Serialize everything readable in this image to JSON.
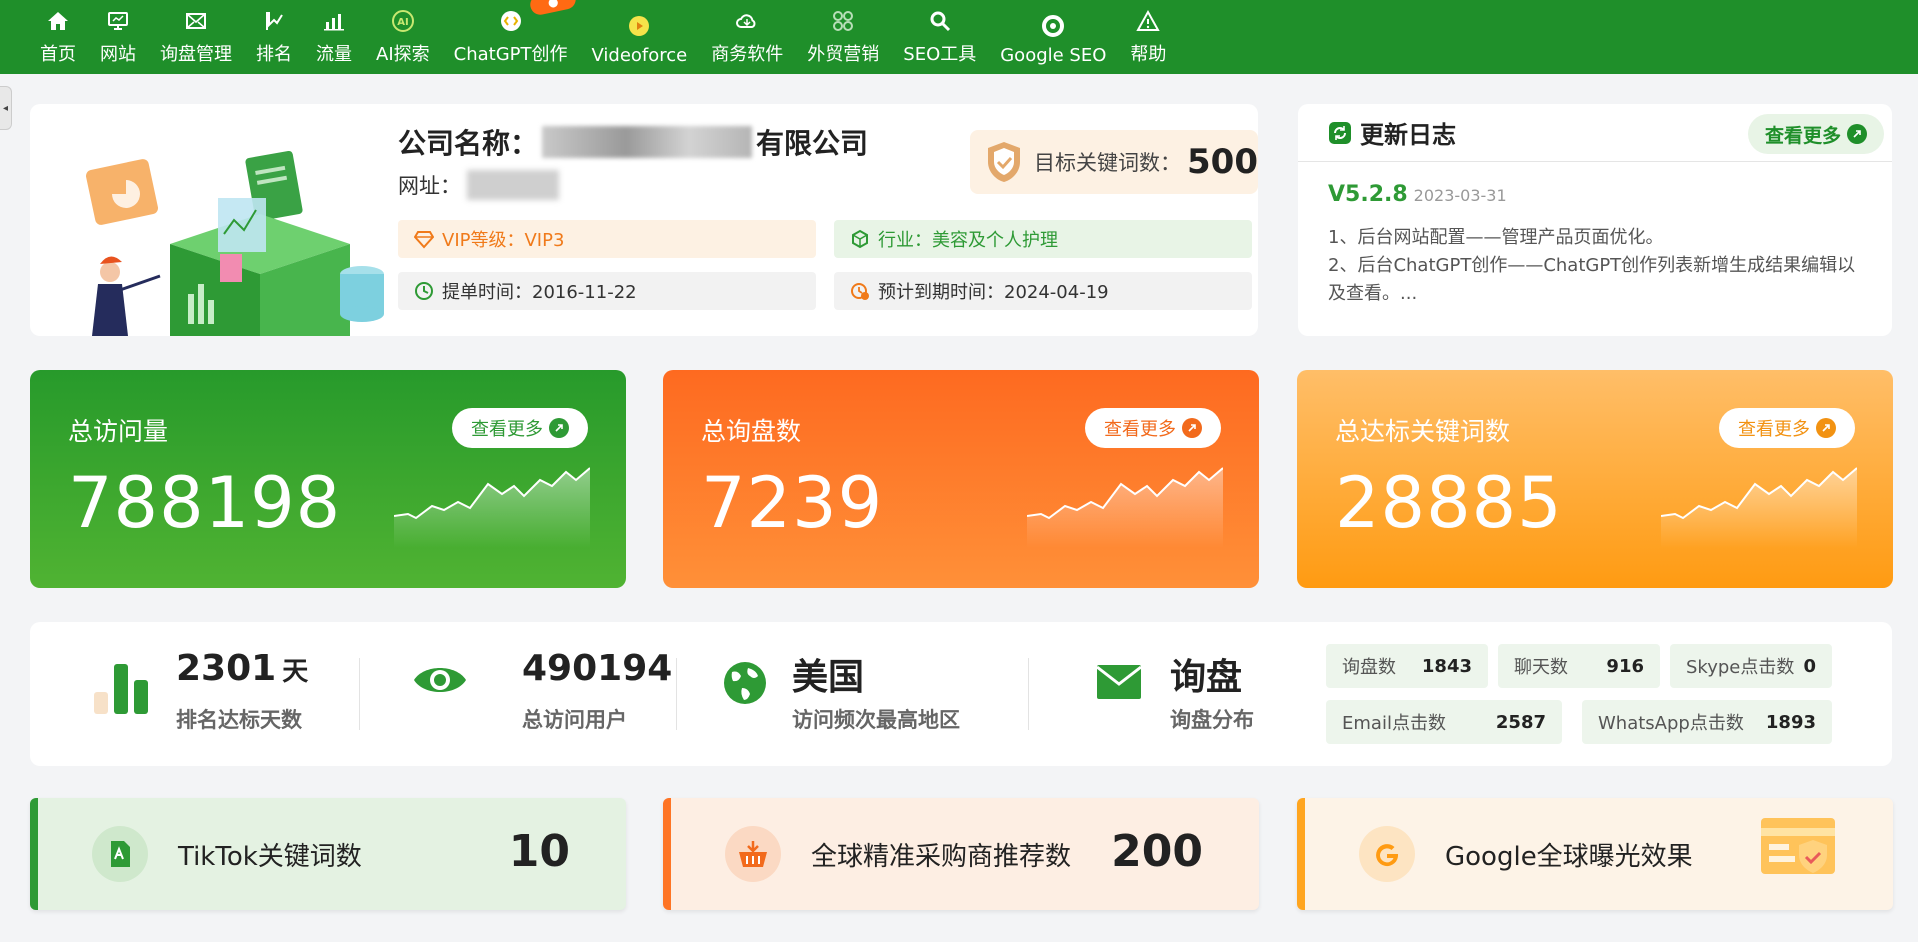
{
  "nav": {
    "items": [
      {
        "label": "首页",
        "icon": "home-icon"
      },
      {
        "label": "网站",
        "icon": "monitor-icon"
      },
      {
        "label": "询盘管理",
        "icon": "envelope-icon"
      },
      {
        "label": "排名",
        "icon": "ranking-icon"
      },
      {
        "label": "流量",
        "icon": "bar-chart-icon"
      },
      {
        "label": "AI探索",
        "icon": "ai-icon"
      },
      {
        "label": "ChatGPT创作",
        "icon": "chatgpt-icon"
      },
      {
        "label": "Videoforce",
        "icon": "video-icon"
      },
      {
        "label": "商务软件",
        "icon": "cloud-icon"
      },
      {
        "label": "外贸营销",
        "icon": "grid-icon"
      },
      {
        "label": "SEO工具",
        "icon": "search-icon"
      },
      {
        "label": "Google SEO",
        "icon": "google-icon"
      },
      {
        "label": "帮助",
        "icon": "warning-icon"
      }
    ]
  },
  "company": {
    "name_prefix": "公司名称：",
    "name_suffix": "有限公司",
    "url_label": "网址：",
    "target_label": "目标关键词数：",
    "target_value": "500",
    "vip": "VIP等级：VIP3",
    "industry": "行业：美容及个人护理",
    "order_date": "提单时间：2016-11-22",
    "expire_date": "预计到期时间：2024-04-19"
  },
  "changelog": {
    "title": "更新日志",
    "more": "查看更多",
    "version": "V5.2.8",
    "date": "2023-03-31",
    "line1": "1、后台网站配置——管理产品页面优化。",
    "line2": "2、后台ChatGPT创作——ChatGPT创作列表新增生成结果编辑以及查看。..."
  },
  "stats": {
    "visits": {
      "label": "总访问量",
      "value": "788198",
      "more": "查看更多"
    },
    "inquiries": {
      "label": "总询盘数",
      "value": "7239",
      "more": "查看更多"
    },
    "keywords": {
      "label": "总达标关键词数",
      "value": "28885",
      "more": "查看更多"
    }
  },
  "metrics": {
    "days": {
      "value": "2301",
      "unit": "天",
      "label": "排名达标天数"
    },
    "users": {
      "value": "490194",
      "label": "总访问用户"
    },
    "region": {
      "value": "美国",
      "label": "访问频次最高地区"
    },
    "inquiry": {
      "value": "询盘",
      "label": "询盘分布"
    },
    "chips": [
      {
        "label": "询盘数",
        "value": "1843"
      },
      {
        "label": "聊天数",
        "value": "916"
      },
      {
        "label": "Skype点击数",
        "value": "0"
      },
      {
        "label": "Email点击数",
        "value": "2587"
      },
      {
        "label": "WhatsApp点击数",
        "value": "1893"
      }
    ]
  },
  "bottom": {
    "tiktok": {
      "label": "TikTok关键词数",
      "value": "10"
    },
    "buyers": {
      "label": "全球精准采购商推荐数",
      "value": "200"
    },
    "google": {
      "label": "Google全球曝光效果"
    }
  },
  "colors": {
    "brand_green": "#1f8f2a",
    "orange": "#fe6a20",
    "yellow": "#ff9b12"
  }
}
